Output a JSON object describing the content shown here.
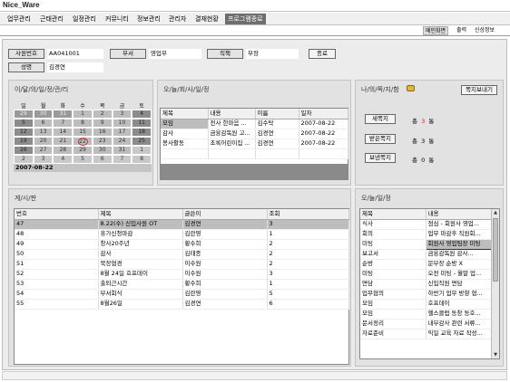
{
  "app": {
    "title": "Nice_Ware"
  },
  "menu": [
    "업무관리",
    "근태관리",
    "일정관리",
    "커뮤니티",
    "정보관리",
    "관리자",
    "결재현황",
    "프로그램종료"
  ],
  "tabs": [
    "메인화면",
    "출력",
    "신상정보"
  ],
  "profile": {
    "emp_no_label": "사원번호",
    "emp_no": "AA041001",
    "dept_label": "부서",
    "dept": "영업부",
    "position_label": "직책",
    "position": "부장",
    "name_label": "성명",
    "name": "김경연",
    "confirm_label": "종료"
  },
  "calendar": {
    "title": "이/달/의/일/정/관/리",
    "weekdays": [
      "일",
      "월",
      "화",
      "수",
      "목",
      "금",
      "토"
    ],
    "weeks": [
      [
        "29",
        "30",
        "31",
        "1",
        "2",
        "3",
        "4"
      ],
      [
        "5",
        "6",
        "7",
        "8",
        "9",
        "10",
        "11"
      ],
      [
        "12",
        "13",
        "14",
        "15",
        "16",
        "17",
        "18"
      ],
      [
        "19",
        "20",
        "21",
        "22",
        "23",
        "24",
        "25"
      ],
      [
        "26",
        "27",
        "28",
        "29",
        "30",
        "31",
        "1"
      ],
      [
        "2",
        "3",
        "4",
        "5",
        "6",
        "7",
        "8"
      ]
    ],
    "today": "22",
    "selected_date": "2007-08-22"
  },
  "today_schedule": {
    "title": "오/늘/회/사/일/정",
    "headers": [
      "제목",
      "내용",
      "이름",
      "일자"
    ],
    "rows": [
      [
        "모임",
        "전사 한마음 ...",
        "김수탁",
        "2007-08-22"
      ],
      [
        "감사",
        "금융감독원 고...",
        "김경연",
        "2007-08-22"
      ],
      [
        "봉사활동",
        "초록어린이집 ...",
        "김경연",
        "2007-08-22"
      ]
    ]
  },
  "board": {
    "title": "게/시/판",
    "headers": [
      "번호",
      "제목",
      "글쓴이",
      "조회"
    ],
    "rows": [
      [
        "47",
        "8.22(수) 신입사원 OT",
        "김경연",
        "3"
      ],
      [
        "48",
        "휴가신청마감",
        "김란영",
        "1"
      ],
      [
        "49",
        "창사20주년",
        "황수희",
        "2"
      ],
      [
        "50",
        "감사",
        "김태종",
        "2"
      ],
      [
        "51",
        "북장협경",
        "이수원",
        "2"
      ],
      [
        "52",
        "8월 24일 호프데이",
        "이수원",
        "3"
      ],
      [
        "53",
        "출퇴근시간",
        "황수희",
        "1"
      ],
      [
        "54",
        "부서회식",
        "김란영",
        "5"
      ],
      [
        "55",
        "8월26일",
        "김경연",
        "6"
      ]
    ]
  },
  "messages": {
    "title": "나/의/쪽/지/함",
    "compose_label": "쪽지보내기",
    "items": [
      {
        "label": "새쪽지",
        "prefix": "총",
        "count": "3",
        "suffix": "통",
        "alert": true
      },
      {
        "label": "받은쪽지",
        "prefix": "총",
        "count": "3",
        "suffix": "통",
        "alert": false
      },
      {
        "label": "보낸쪽지",
        "prefix": "총",
        "count": "0",
        "suffix": "통",
        "alert": false
      }
    ]
  },
  "my_schedule": {
    "title": "오/늘/일/정",
    "headers": [
      "제목",
      "내용"
    ],
    "rows": [
      [
        "식사",
        "점심 - 회원사 영업..."
      ],
      [
        "회의",
        "업무 마감후 직원회..."
      ],
      [
        "미팅",
        "회원사 영업팀장 미팅"
      ],
      [
        "보고서",
        "금융감독원 감사..."
      ],
      [
        "순방",
        "문부장 순방 X"
      ],
      [
        "미팅",
        "오전 미팅 - 월말 업..."
      ],
      [
        "면담",
        "신입직원 면담"
      ],
      [
        "업무협의",
        "하반기 업무 방향 협..."
      ],
      [
        "모임",
        "호프데이"
      ],
      [
        "모임",
        "헬스클럽 동창 동호..."
      ],
      [
        "문서정리",
        "내부감사 관련 서류..."
      ],
      [
        "자료준비",
        "익일 교육 자료 작성..."
      ]
    ]
  },
  "colors": {
    "accent_red": "#d02020",
    "panel": "#e2e2e2",
    "dark": "#8a8a8a"
  }
}
